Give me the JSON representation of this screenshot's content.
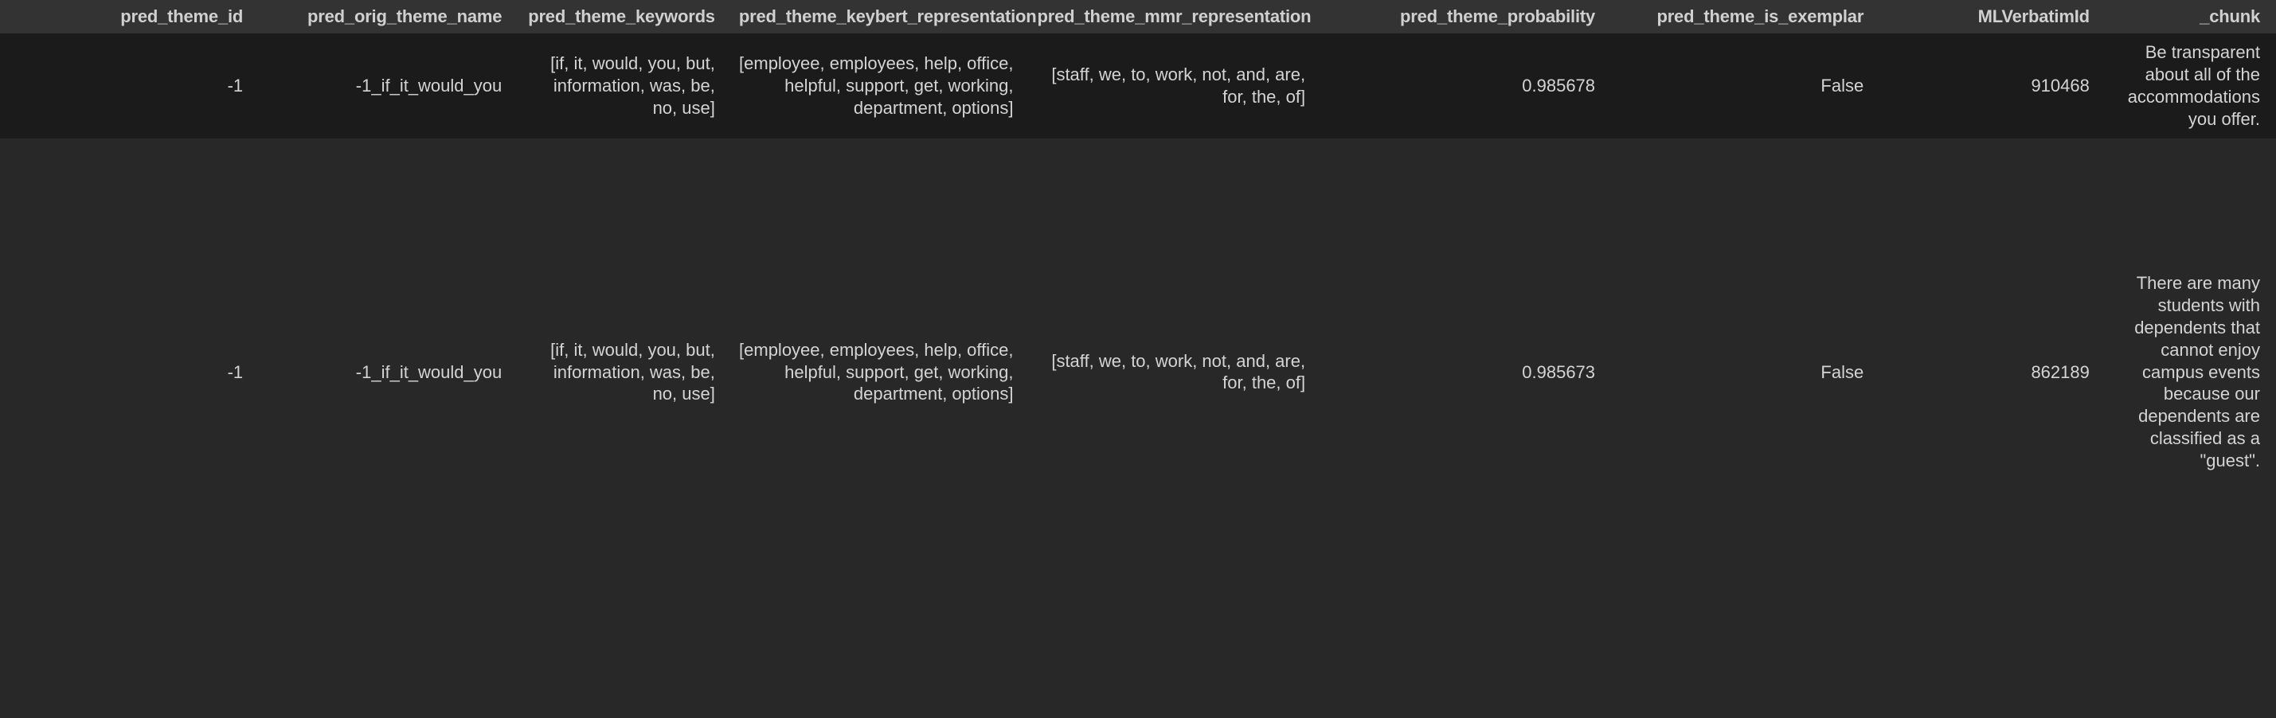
{
  "view": {
    "kind": "dataframe-table",
    "background_color": "#282828",
    "header_background_color": "#333333",
    "row_stripe_color": "#1b1b1b",
    "text_color": "#d4d4d4",
    "header_text_color": "#d0d0d0",
    "alignment": "right"
  },
  "table": {
    "columns": [
      {
        "key": "pred_theme_id",
        "label": "pred_theme_id"
      },
      {
        "key": "pred_orig_theme_name",
        "label": "pred_orig_theme_name"
      },
      {
        "key": "pred_theme_keywords",
        "label": "pred_theme_keywords"
      },
      {
        "key": "pred_theme_keybert_representation",
        "label": "pred_theme_keybert_representation"
      },
      {
        "key": "pred_theme_mmr_representation",
        "label": "pred_theme_mmr_representation"
      },
      {
        "key": "pred_theme_probability",
        "label": "pred_theme_probability"
      },
      {
        "key": "pred_theme_is_exemplar",
        "label": "pred_theme_is_exemplar"
      },
      {
        "key": "MLVerbatimId",
        "label": "MLVerbatimId"
      },
      {
        "key": "_chunk",
        "label": "_chunk"
      }
    ],
    "rows": [
      {
        "pred_theme_id": "-1",
        "pred_orig_theme_name": "-1_if_it_would_you",
        "pred_theme_keywords": "[if, it, would, you, but, information, was, be, no, use]",
        "pred_theme_keybert_representation": "[employee, employees, help, office, helpful, support, get, working, department, options]",
        "pred_theme_mmr_representation": "[staff, we, to, work, not, and, are, for, the, of]",
        "pred_theme_probability": "0.985678",
        "pred_theme_is_exemplar": "False",
        "MLVerbatimId": "910468",
        "_chunk": "Be transparent about all of the accommodations you offer."
      },
      {
        "pred_theme_id": "-1",
        "pred_orig_theme_name": "-1_if_it_would_you",
        "pred_theme_keywords": "[if, it, would, you, but, information, was, be, no, use]",
        "pred_theme_keybert_representation": "[employee, employees, help, office, helpful, support, get, working, department, options]",
        "pred_theme_mmr_representation": "[staff, we, to, work, not, and, are, for, the, of]",
        "pred_theme_probability": "0.985673",
        "pred_theme_is_exemplar": "False",
        "MLVerbatimId": "862189",
        "_chunk": "There are many students with dependents that cannot enjoy campus events because our dependents are classified as a \"guest\"."
      }
    ]
  }
}
